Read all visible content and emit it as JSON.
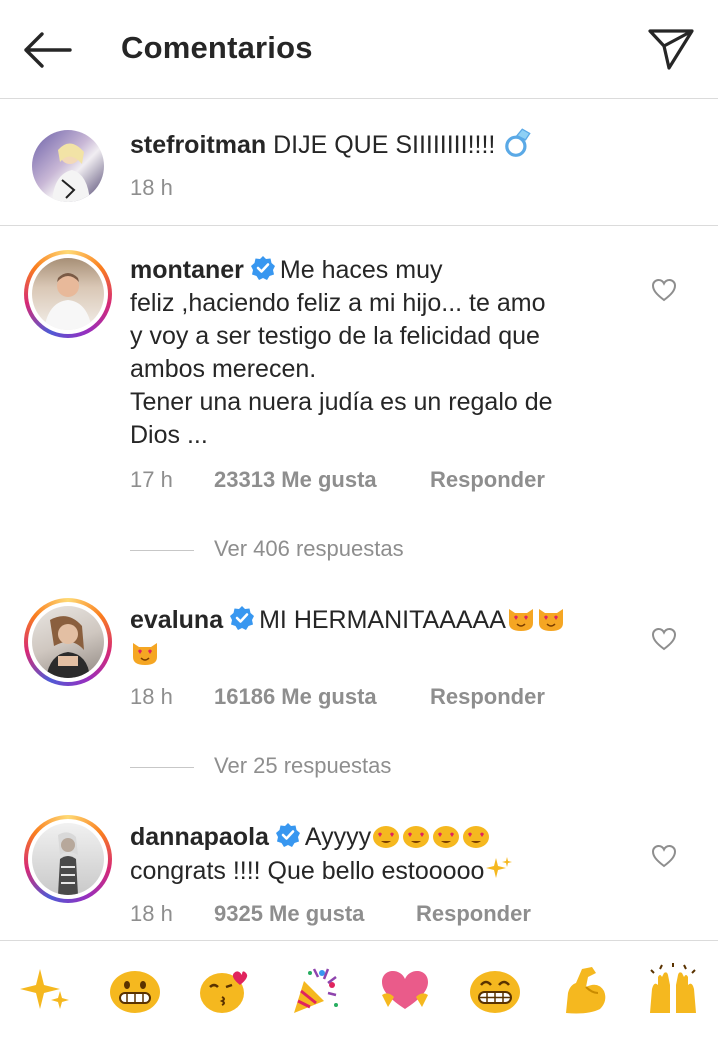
{
  "header": {
    "title": "Comentarios"
  },
  "caption": {
    "username": "stefroitman",
    "text": "DIJE QUE SIIIIIIII!!!!",
    "time": "18 h"
  },
  "comments": [
    {
      "username": "montaner",
      "lines": [
        "Me haces muy",
        "feliz ,haciendo feliz a mi hijo... te amo",
        "y voy a ser testigo de la felicidad que",
        "ambos merecen.",
        "Tener una nuera judía es un regalo de",
        "Dios ..."
      ],
      "time": "17 h",
      "likes": "23313 Me gusta",
      "reply": "Responder",
      "view_replies": "Ver 406 respuestas"
    },
    {
      "username": "evaluna",
      "text": "MI HERMANITAAAAA",
      "time": "18 h",
      "likes": "16186 Me gusta",
      "reply": "Responder",
      "view_replies": "Ver 25 respuestas"
    },
    {
      "username": "dannapaola",
      "text1": "Ayyyy",
      "text2": "congrats !!!! Que bello estooooo",
      "time": "18 h",
      "likes": "9325 Me gusta",
      "reply": "Responder"
    }
  ],
  "quick_emojis": [
    "sparkles-icon",
    "grinning-face-icon",
    "kissing-face-icon",
    "party-popper-icon",
    "heart-hands-icon",
    "beaming-face-icon",
    "flexed-biceps-icon",
    "raising-hands-icon"
  ],
  "colors": {
    "text": "#262626",
    "meta": "#8e8e8e",
    "verified": "#3897f0",
    "divider": "#dbdbdb"
  }
}
